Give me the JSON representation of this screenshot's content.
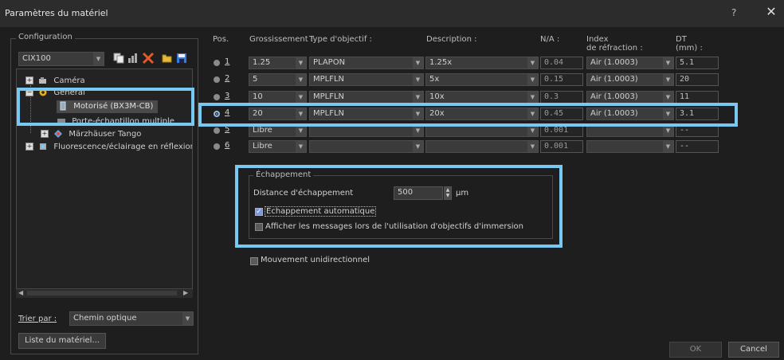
{
  "window": {
    "title": "Paramètres du matériel",
    "help": "?",
    "close": "✕"
  },
  "config": {
    "legend": "Configuration",
    "selected": "CIX100",
    "tree": [
      {
        "label": "Caméra"
      },
      {
        "label": "Général"
      },
      {
        "label": "Motorisé (BX3M-CB)"
      },
      {
        "label": "Porte-échantillon multiple"
      },
      {
        "label": "Märzhäuser Tango"
      },
      {
        "label": "Fluorescence/éclairage en réflexion"
      }
    ],
    "sort_label": "Trier par :",
    "sort_value": "Chemin optique",
    "list_button": "Liste du matériel..."
  },
  "table": {
    "headers": {
      "pos": "Pos.",
      "mag": "Grossissement :",
      "type": "Type d'objectif :",
      "desc": "Description :",
      "na": "N/A :",
      "index_line1": "Index",
      "index_line2": "de réfraction :",
      "wd_line1": "DT",
      "wd_line2": "(mm) :"
    },
    "rows": [
      {
        "pos": "1",
        "mag": "1.25",
        "type": "PLAPON",
        "desc": "1.25x",
        "na": "0.04",
        "index": "Air (1.0003)",
        "wd": "5.1"
      },
      {
        "pos": "2",
        "mag": "5",
        "type": "MPLFLN",
        "desc": "5x",
        "na": "0.15",
        "index": "Air (1.0003)",
        "wd": "20"
      },
      {
        "pos": "3",
        "mag": "10",
        "type": "MPLFLN",
        "desc": "10x",
        "na": "0.3",
        "index": "Air (1.0003)",
        "wd": "11"
      },
      {
        "pos": "4",
        "mag": "20",
        "type": "MPLFLN",
        "desc": "20x",
        "na": "0.45",
        "index": "Air (1.0003)",
        "wd": "3.1"
      },
      {
        "pos": "5",
        "mag": "Libre",
        "type": "",
        "desc": "",
        "na": "0.001",
        "index": "",
        "wd": "--"
      },
      {
        "pos": "6",
        "mag": "Libre",
        "type": "",
        "desc": "",
        "na": "0.001",
        "index": "",
        "wd": "--"
      }
    ],
    "selected_pos": "4"
  },
  "escape": {
    "legend": "Échappement",
    "distance_label": "Distance d'échappement",
    "distance_value": "500",
    "unit": "µm",
    "auto_label": "Échappement automatique",
    "auto_checked": true,
    "immersion_label": "Afficher les messages lors de l'utilisation d'objectifs d'immersion",
    "immersion_checked": false
  },
  "unidirectional_label": "Mouvement unidirectionnel",
  "buttons": {
    "ok": "OK",
    "cancel": "Cancel"
  }
}
